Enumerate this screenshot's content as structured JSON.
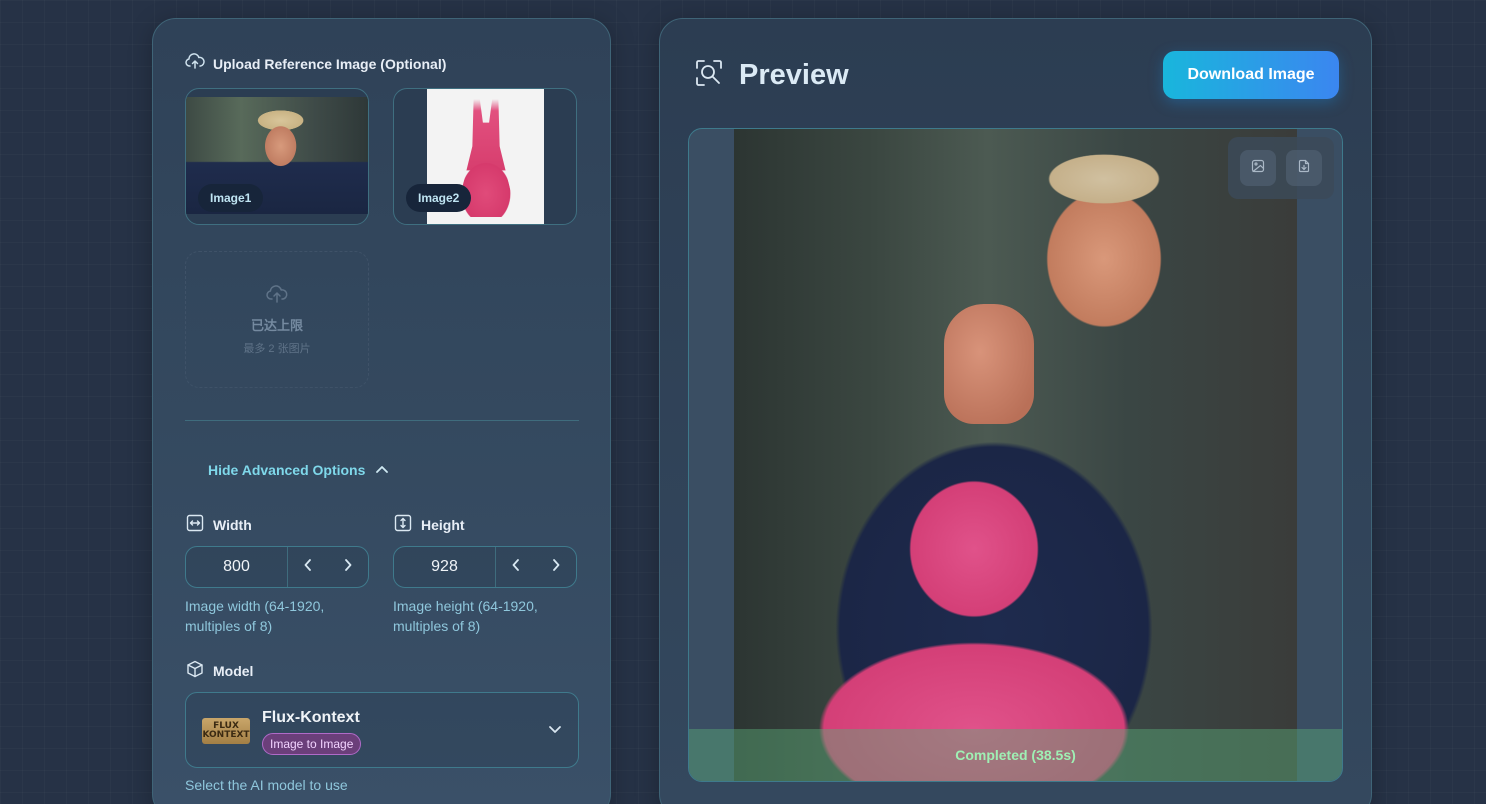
{
  "upload": {
    "title": "Upload Reference Image (Optional)",
    "images": [
      {
        "tag": "Image1"
      },
      {
        "tag": "Image2"
      }
    ],
    "limit_title": "已达上限",
    "limit_subtitle": "最多 2 张图片"
  },
  "advanced": {
    "toggle_label": "Hide Advanced Options",
    "width": {
      "label": "Width",
      "value": "800",
      "hint": "Image width (64-1920, multiples of 8)"
    },
    "height": {
      "label": "Height",
      "value": "928",
      "hint": "Image height (64-1920, multiples of 8)"
    },
    "model": {
      "label": "Model",
      "logo_text_1": "FLUX",
      "logo_text_2": "KONTEXT",
      "name": "Flux-Kontext",
      "badge": "Image to Image",
      "hint": "Select the AI model to use"
    }
  },
  "preview": {
    "title": "Preview",
    "download_label": "Download Image",
    "status": "Completed (38.5s)"
  },
  "colors": {
    "accent": "#7fd8ea",
    "download_gradient_start": "#19b6dc",
    "download_gradient_end": "#3b86f0",
    "badge_bg": "#6b3f7a",
    "status_text": "#9ff0b4"
  },
  "icons": [
    "cloud-upload-icon",
    "arrows-horizontal-icon",
    "arrows-vertical-icon",
    "cube-icon",
    "chevron-up-icon",
    "chevron-down-icon",
    "chevron-left-icon",
    "chevron-right-icon",
    "search-image-icon",
    "image-icon",
    "file-icon"
  ]
}
